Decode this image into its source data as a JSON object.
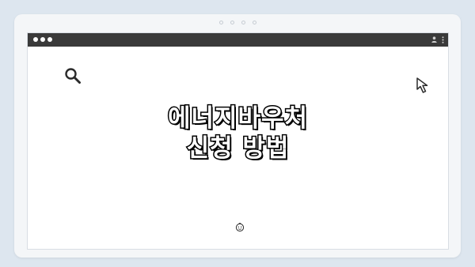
{
  "headline": {
    "line1": "에너지바우처",
    "line2": "신청 방법"
  },
  "icons": {
    "window_controls": "traffic-light-dots",
    "user": "user-icon",
    "menu": "kebab-menu-icon",
    "search": "search-icon",
    "cursor": "cursor-arrow-icon",
    "smiley": "smiley-icon"
  },
  "colors": {
    "background": "#dde6ef",
    "titlebar": "#3a3a3a",
    "page": "#ffffff",
    "headline_fill": "#ffffff",
    "headline_outline": "#000000"
  }
}
